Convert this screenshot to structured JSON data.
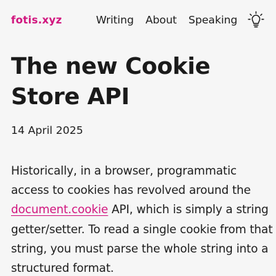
{
  "header": {
    "brand": "fotis.xyz",
    "nav": [
      {
        "label": "Writing"
      },
      {
        "label": "About"
      },
      {
        "label": "Speaking"
      }
    ],
    "theme_toggle_icon": "lightbulb-icon"
  },
  "article": {
    "title": "The new Cookie Store API",
    "date": "14 April 2025",
    "paragraph": {
      "text_before_link": "Historically, in a browser, programmatic access to cookies has revolved around the ",
      "link_text": "document.cookie",
      "text_after_link": " API, which is simply a string getter/setter. To read a single cookie from that string, you must parse the whole string into a structured format."
    }
  },
  "colors": {
    "accent": "#d1157e",
    "background": "#f6f6f6",
    "text": "#1c1c1c"
  }
}
